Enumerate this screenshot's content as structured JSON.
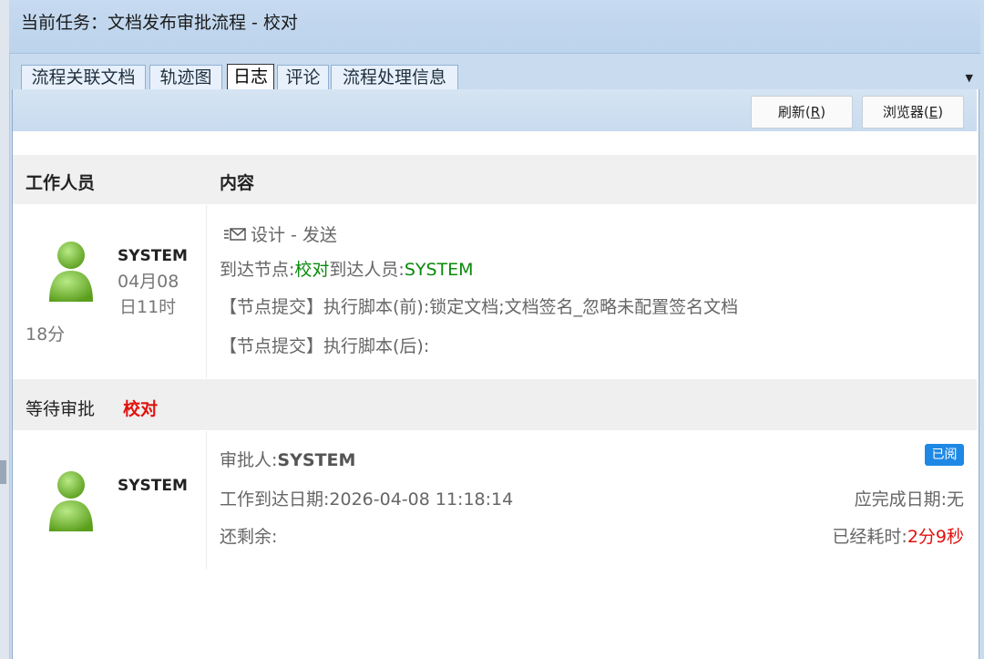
{
  "task_header": {
    "title": "当前任务：文档发布审批流程  -  校对"
  },
  "tabs": [
    {
      "label": "流程关联文档",
      "active": false
    },
    {
      "label": "轨迹图",
      "active": false
    },
    {
      "label": "日志",
      "active": true
    },
    {
      "label": "评论",
      "active": false
    },
    {
      "label": "流程处理信息",
      "active": false
    }
  ],
  "toolbar": {
    "refresh_label": "刷新(",
    "refresh_key": "R",
    "refresh_close": ")",
    "browser_label": "浏览器(",
    "browser_key": "E",
    "browser_close": ")"
  },
  "columns": {
    "worker": "工作人员",
    "content": "内容"
  },
  "log_entry": {
    "user": "SYSTEM",
    "time_line1": "04月08",
    "time_line2": "日11时",
    "time_line3": "18分",
    "action": "设计 - 发送",
    "arrive_prefix": "到达节点:",
    "arrive_node": "校对",
    "arrive_middle": "到达人员:",
    "arrive_person": "SYSTEM",
    "script_before": "【节点提交】执行脚本(前):锁定文档;文档签名_忽略未配置签名文档",
    "script_after": "【节点提交】执行脚本(后):"
  },
  "pending": {
    "label": "等待审批",
    "node": "校对"
  },
  "approval": {
    "user": "SYSTEM",
    "approver_prefix": "审批人:",
    "approver_name": "SYSTEM",
    "badge": "已阅",
    "arrive_date": "工作到达日期:2026-04-08 11:18:14",
    "due_date": "应完成日期:无",
    "remaining": "还剩余:",
    "elapsed_prefix": "已经耗时:",
    "elapsed_value": "2分9秒"
  },
  "colors": {
    "accent_green": "#0a8a0a",
    "accent_red": "#e0120e",
    "badge_blue": "#1e88e5"
  }
}
